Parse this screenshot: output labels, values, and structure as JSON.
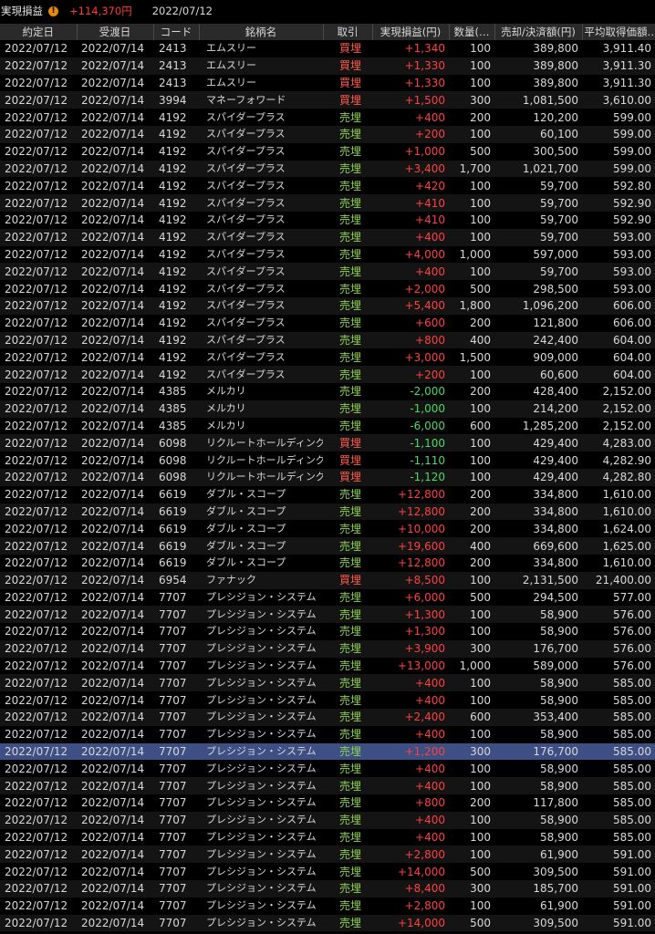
{
  "summary": {
    "label": "実現損益",
    "amount": "+114,370円",
    "date": "2022/07/12"
  },
  "columns": [
    "約定日",
    "受渡日",
    "コード",
    "銘柄名",
    "取引",
    "実現損益(円)",
    "数量(…",
    "売却/決済額(円)",
    "平均取得価額…"
  ],
  "rows": [
    [
      "2022/07/12",
      "2022/07/14",
      "2413",
      "エムスリー",
      "買埋",
      "+1,340",
      "100",
      "389,800",
      "3,911.40"
    ],
    [
      "2022/07/12",
      "2022/07/14",
      "2413",
      "エムスリー",
      "買埋",
      "+1,330",
      "100",
      "389,800",
      "3,911.30"
    ],
    [
      "2022/07/12",
      "2022/07/14",
      "2413",
      "エムスリー",
      "買埋",
      "+1,330",
      "100",
      "389,800",
      "3,911.30"
    ],
    [
      "2022/07/12",
      "2022/07/14",
      "3994",
      "マネーフォワード",
      "買埋",
      "+1,500",
      "300",
      "1,081,500",
      "3,610.00"
    ],
    [
      "2022/07/12",
      "2022/07/14",
      "4192",
      "スパイダープラス",
      "売埋",
      "+400",
      "200",
      "120,200",
      "599.00"
    ],
    [
      "2022/07/12",
      "2022/07/14",
      "4192",
      "スパイダープラス",
      "売埋",
      "+200",
      "100",
      "60,100",
      "599.00"
    ],
    [
      "2022/07/12",
      "2022/07/14",
      "4192",
      "スパイダープラス",
      "売埋",
      "+1,000",
      "500",
      "300,500",
      "599.00"
    ],
    [
      "2022/07/12",
      "2022/07/14",
      "4192",
      "スパイダープラス",
      "売埋",
      "+3,400",
      "1,700",
      "1,021,700",
      "599.00"
    ],
    [
      "2022/07/12",
      "2022/07/14",
      "4192",
      "スパイダープラス",
      "売埋",
      "+420",
      "100",
      "59,700",
      "592.80"
    ],
    [
      "2022/07/12",
      "2022/07/14",
      "4192",
      "スパイダープラス",
      "売埋",
      "+410",
      "100",
      "59,700",
      "592.90"
    ],
    [
      "2022/07/12",
      "2022/07/14",
      "4192",
      "スパイダープラス",
      "売埋",
      "+410",
      "100",
      "59,700",
      "592.90"
    ],
    [
      "2022/07/12",
      "2022/07/14",
      "4192",
      "スパイダープラス",
      "売埋",
      "+400",
      "100",
      "59,700",
      "593.00"
    ],
    [
      "2022/07/12",
      "2022/07/14",
      "4192",
      "スパイダープラス",
      "売埋",
      "+4,000",
      "1,000",
      "597,000",
      "593.00"
    ],
    [
      "2022/07/12",
      "2022/07/14",
      "4192",
      "スパイダープラス",
      "売埋",
      "+400",
      "100",
      "59,700",
      "593.00"
    ],
    [
      "2022/07/12",
      "2022/07/14",
      "4192",
      "スパイダープラス",
      "売埋",
      "+2,000",
      "500",
      "298,500",
      "593.00"
    ],
    [
      "2022/07/12",
      "2022/07/14",
      "4192",
      "スパイダープラス",
      "売埋",
      "+5,400",
      "1,800",
      "1,096,200",
      "606.00"
    ],
    [
      "2022/07/12",
      "2022/07/14",
      "4192",
      "スパイダープラス",
      "売埋",
      "+600",
      "200",
      "121,800",
      "606.00"
    ],
    [
      "2022/07/12",
      "2022/07/14",
      "4192",
      "スパイダープラス",
      "売埋",
      "+800",
      "400",
      "242,400",
      "604.00"
    ],
    [
      "2022/07/12",
      "2022/07/14",
      "4192",
      "スパイダープラス",
      "売埋",
      "+3,000",
      "1,500",
      "909,000",
      "604.00"
    ],
    [
      "2022/07/12",
      "2022/07/14",
      "4192",
      "スパイダープラス",
      "売埋",
      "+200",
      "100",
      "60,600",
      "604.00"
    ],
    [
      "2022/07/12",
      "2022/07/14",
      "4385",
      "メルカリ",
      "売埋",
      "-2,000",
      "200",
      "428,400",
      "2,152.00"
    ],
    [
      "2022/07/12",
      "2022/07/14",
      "4385",
      "メルカリ",
      "売埋",
      "-1,000",
      "100",
      "214,200",
      "2,152.00"
    ],
    [
      "2022/07/12",
      "2022/07/14",
      "4385",
      "メルカリ",
      "売埋",
      "-6,000",
      "600",
      "1,285,200",
      "2,152.00"
    ],
    [
      "2022/07/12",
      "2022/07/14",
      "6098",
      "リクルートホールディングス",
      "買埋",
      "-1,100",
      "100",
      "429,400",
      "4,283.00"
    ],
    [
      "2022/07/12",
      "2022/07/14",
      "6098",
      "リクルートホールディングス",
      "買埋",
      "-1,110",
      "100",
      "429,400",
      "4,282.90"
    ],
    [
      "2022/07/12",
      "2022/07/14",
      "6098",
      "リクルートホールディングス",
      "買埋",
      "-1,120",
      "100",
      "429,400",
      "4,282.80"
    ],
    [
      "2022/07/12",
      "2022/07/14",
      "6619",
      "ダブル・スコープ",
      "売埋",
      "+12,800",
      "200",
      "334,800",
      "1,610.00"
    ],
    [
      "2022/07/12",
      "2022/07/14",
      "6619",
      "ダブル・スコープ",
      "売埋",
      "+12,800",
      "200",
      "334,800",
      "1,610.00"
    ],
    [
      "2022/07/12",
      "2022/07/14",
      "6619",
      "ダブル・スコープ",
      "売埋",
      "+10,000",
      "200",
      "334,800",
      "1,624.00"
    ],
    [
      "2022/07/12",
      "2022/07/14",
      "6619",
      "ダブル・スコープ",
      "売埋",
      "+19,600",
      "400",
      "669,600",
      "1,625.00"
    ],
    [
      "2022/07/12",
      "2022/07/14",
      "6619",
      "ダブル・スコープ",
      "売埋",
      "+12,800",
      "200",
      "334,800",
      "1,610.00"
    ],
    [
      "2022/07/12",
      "2022/07/14",
      "6954",
      "ファナック",
      "買埋",
      "+8,500",
      "100",
      "2,131,500",
      "21,400.00"
    ],
    [
      "2022/07/12",
      "2022/07/14",
      "7707",
      "プレシジョン・システム",
      "売埋",
      "+6,000",
      "500",
      "294,500",
      "577.00"
    ],
    [
      "2022/07/12",
      "2022/07/14",
      "7707",
      "プレシジョン・システム",
      "売埋",
      "+1,300",
      "100",
      "58,900",
      "576.00"
    ],
    [
      "2022/07/12",
      "2022/07/14",
      "7707",
      "プレシジョン・システム",
      "売埋",
      "+1,300",
      "100",
      "58,900",
      "576.00"
    ],
    [
      "2022/07/12",
      "2022/07/14",
      "7707",
      "プレシジョン・システム",
      "売埋",
      "+3,900",
      "300",
      "176,700",
      "576.00"
    ],
    [
      "2022/07/12",
      "2022/07/14",
      "7707",
      "プレシジョン・システム",
      "売埋",
      "+13,000",
      "1,000",
      "589,000",
      "576.00"
    ],
    [
      "2022/07/12",
      "2022/07/14",
      "7707",
      "プレシジョン・システム",
      "売埋",
      "+400",
      "100",
      "58,900",
      "585.00"
    ],
    [
      "2022/07/12",
      "2022/07/14",
      "7707",
      "プレシジョン・システム",
      "売埋",
      "+400",
      "100",
      "58,900",
      "585.00"
    ],
    [
      "2022/07/12",
      "2022/07/14",
      "7707",
      "プレシジョン・システム",
      "売埋",
      "+2,400",
      "600",
      "353,400",
      "585.00"
    ],
    [
      "2022/07/12",
      "2022/07/14",
      "7707",
      "プレシジョン・システム",
      "売埋",
      "+400",
      "100",
      "58,900",
      "585.00"
    ],
    [
      "2022/07/12",
      "2022/07/14",
      "7707",
      "プレシジョン・システム",
      "売埋",
      "+1,200",
      "300",
      "176,700",
      "585.00"
    ],
    [
      "2022/07/12",
      "2022/07/14",
      "7707",
      "プレシジョン・システム",
      "売埋",
      "+400",
      "100",
      "58,900",
      "585.00"
    ],
    [
      "2022/07/12",
      "2022/07/14",
      "7707",
      "プレシジョン・システム",
      "売埋",
      "+400",
      "100",
      "58,900",
      "585.00"
    ],
    [
      "2022/07/12",
      "2022/07/14",
      "7707",
      "プレシジョン・システム",
      "売埋",
      "+800",
      "200",
      "117,800",
      "585.00"
    ],
    [
      "2022/07/12",
      "2022/07/14",
      "7707",
      "プレシジョン・システム",
      "売埋",
      "+400",
      "100",
      "58,900",
      "585.00"
    ],
    [
      "2022/07/12",
      "2022/07/14",
      "7707",
      "プレシジョン・システム",
      "売埋",
      "+400",
      "100",
      "58,900",
      "585.00"
    ],
    [
      "2022/07/12",
      "2022/07/14",
      "7707",
      "プレシジョン・システム",
      "売埋",
      "+2,800",
      "100",
      "61,900",
      "591.00"
    ],
    [
      "2022/07/12",
      "2022/07/14",
      "7707",
      "プレシジョン・システム",
      "売埋",
      "+14,000",
      "500",
      "309,500",
      "591.00"
    ],
    [
      "2022/07/12",
      "2022/07/14",
      "7707",
      "プレシジョン・システム",
      "売埋",
      "+8,400",
      "300",
      "185,700",
      "591.00"
    ],
    [
      "2022/07/12",
      "2022/07/14",
      "7707",
      "プレシジョン・システム",
      "売埋",
      "+2,800",
      "100",
      "61,900",
      "591.00"
    ],
    [
      "2022/07/12",
      "2022/07/14",
      "7707",
      "プレシジョン・システム",
      "売埋",
      "+14,000",
      "500",
      "309,500",
      "591.00"
    ]
  ],
  "selected_row": 41,
  "colors": {
    "background": "#000000",
    "row_alt": "#141414",
    "header_bg": "#2a2a2a",
    "selected_bg": "#3d4f84",
    "positive": "#ff4040",
    "negative": "#4cd964",
    "buy_close": "#ff5a4a",
    "sell_close": "#8fd14f",
    "warning": "#e8870e"
  },
  "icons": {
    "summary_warning": "warning-icon"
  }
}
